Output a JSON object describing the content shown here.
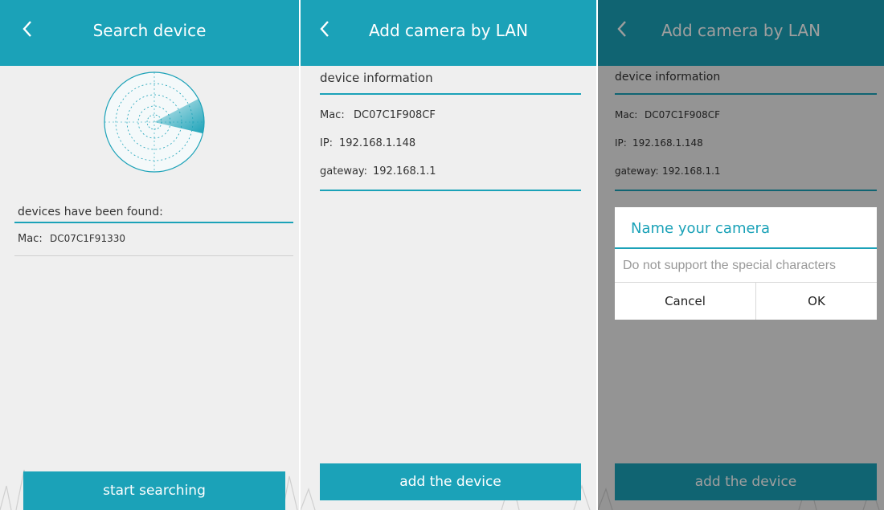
{
  "colors": {
    "accent": "#1ba2b8",
    "background": "#efefef"
  },
  "panel1": {
    "title": "Search device",
    "back_icon": "chevron-left-icon",
    "found_heading": "devices have been found:",
    "devices": [
      {
        "mac_label": "Mac:",
        "mac_value": "DC07C1F91330"
      }
    ],
    "search_button": "start searching"
  },
  "panel2": {
    "title": "Add camera by LAN",
    "back_icon": "chevron-left-icon",
    "section_title": "device information",
    "mac_label": "Mac:",
    "mac_value": "DC07C1F908CF",
    "ip_label": "IP:",
    "ip_value": "192.168.1.148",
    "gateway_label": "gateway:",
    "gateway_value": "192.168.1.1",
    "add_button": "add the device"
  },
  "panel3": {
    "title": "Add camera by LAN",
    "back_icon": "chevron-left-icon",
    "section_title": "device information",
    "mac_label": "Mac:",
    "mac_value": "DC07C1F908CF",
    "ip_label": "IP:",
    "ip_value": "192.168.1.148",
    "gateway_label": "gateway:",
    "gateway_value": "192.168.1.1",
    "add_button": "add the device",
    "dialog": {
      "title": "Name your camera",
      "input_value": "",
      "input_placeholder": "Do not support the special characters",
      "cancel_label": "Cancel",
      "ok_label": "OK"
    }
  }
}
